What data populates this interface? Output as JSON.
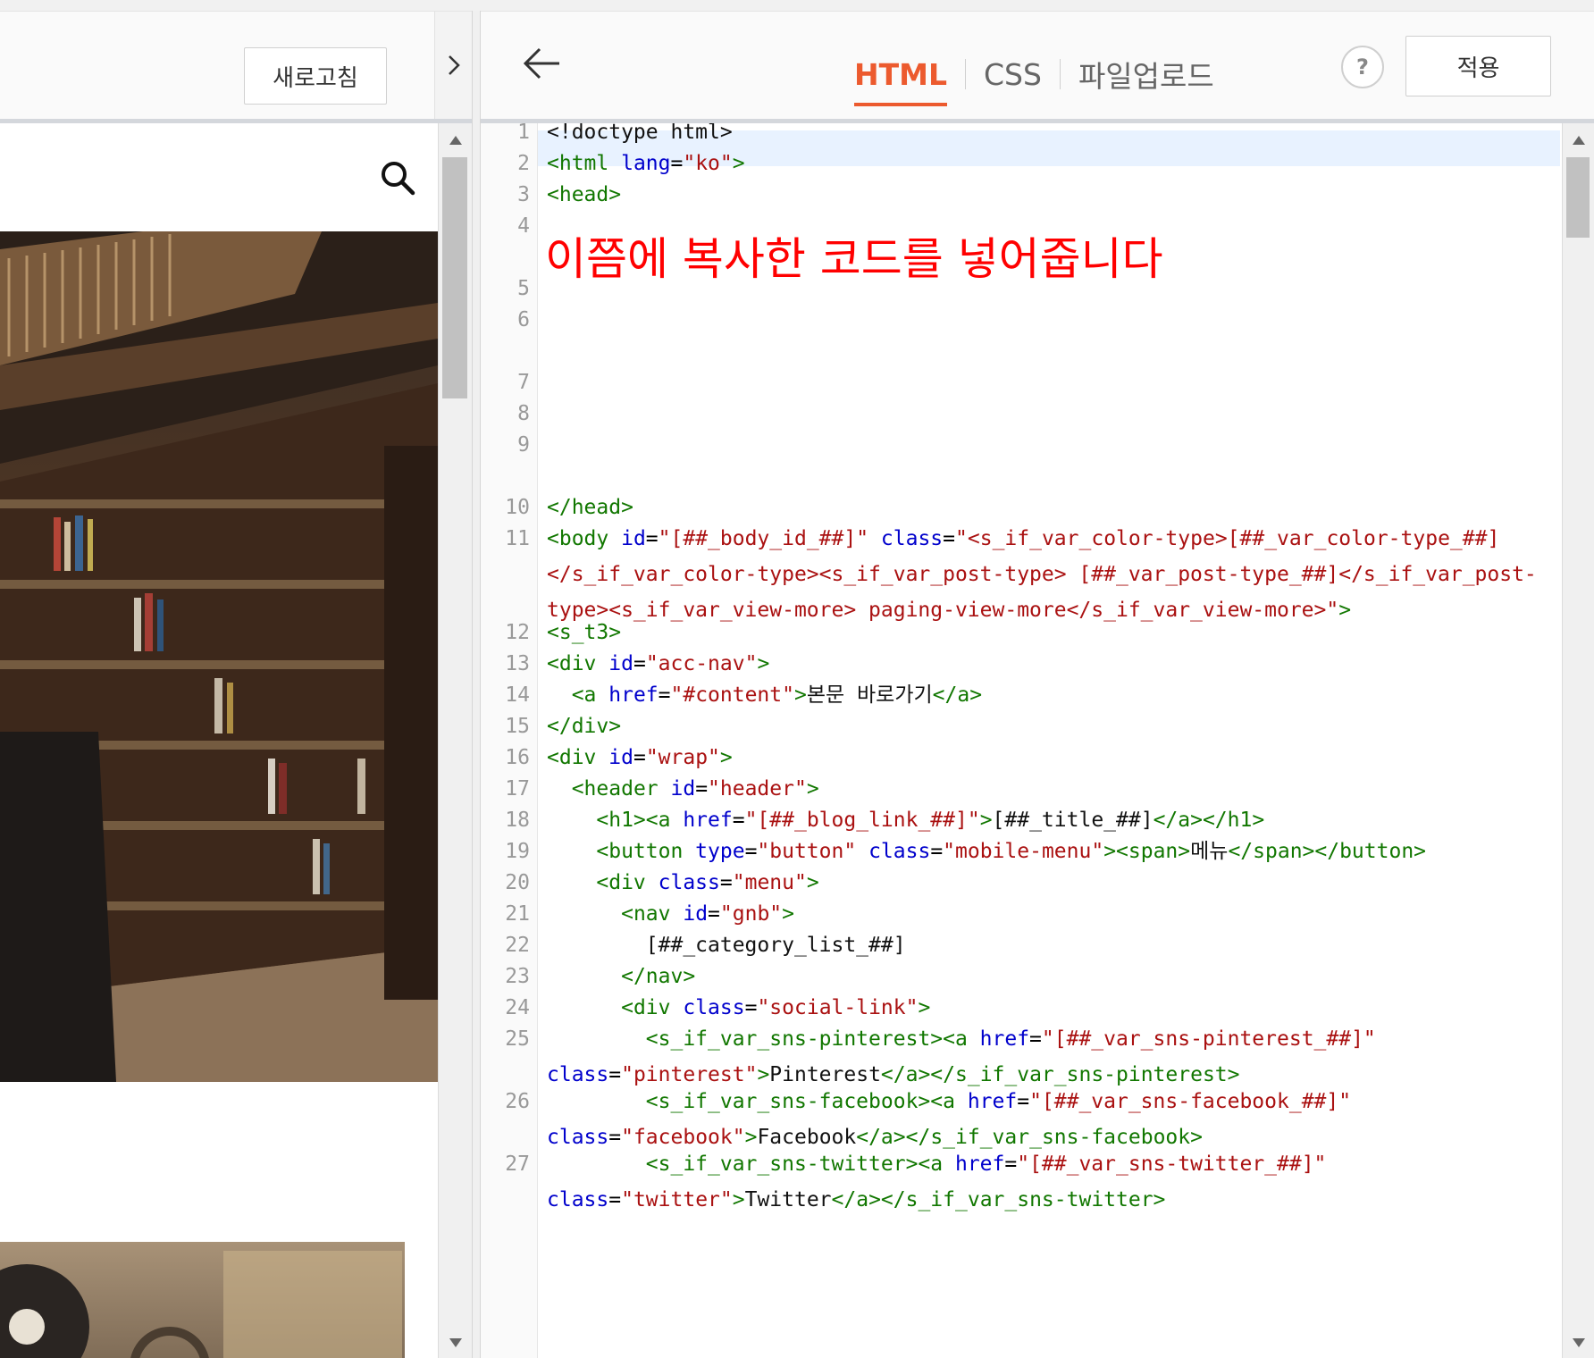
{
  "left_panel": {
    "refresh_label": "새로고침",
    "collapse_icon": "chevron-right-icon",
    "search_icon": "search-icon"
  },
  "editor": {
    "back_icon": "arrow-left-icon",
    "tabs": [
      {
        "label": "HTML",
        "active": true
      },
      {
        "label": "CSS",
        "active": false
      },
      {
        "label": "파일업로드",
        "active": false
      }
    ],
    "help_label": "?",
    "apply_label": "적용",
    "accent_color": "#ec5a2e",
    "annotation": "이쯤에 복사한 코드를 넣어줍니다",
    "line_numbers": [
      "1",
      "2",
      "3",
      "4",
      "5",
      "6",
      "7",
      "8",
      "9",
      "10",
      "11",
      "12",
      "13",
      "14",
      "15",
      "16",
      "17",
      "18",
      "19",
      "20",
      "21",
      "22",
      "23",
      "24",
      "25",
      "26",
      "27"
    ]
  },
  "code": {
    "l1": "<!doctype html>",
    "l2": {
      "open": "<html ",
      "attr": "lang",
      "eq": "=",
      "val": "\"ko\"",
      "close": ">"
    },
    "l3": "<head>",
    "l10": "</head>",
    "l11": {
      "open": "<body ",
      "a1": "id",
      "eq": "=",
      "v1": "\"[##_body_id_##]\"",
      "a2": "class",
      "v2": "\"<s_if_var_color-type>[##_var_color-type_##]</s_if_var_color-type><s_if_var_post-type> [##_var_post-type_##]</s_if_var_post-type><s_if_var_view-more> paging-view-more</s_if_var_view-more>\"",
      "close": ">"
    },
    "l12": "<s_t3>",
    "l13": {
      "open": "<div ",
      "attr": "id",
      "eq": "=",
      "val": "\"acc-nav\"",
      "close": ">"
    },
    "l14": {
      "indent": "  ",
      "open": "<a ",
      "attr": "href",
      "eq": "=",
      "val": "\"#content\"",
      "close": ">",
      "text": "본문 바로가기",
      "end": "</a>"
    },
    "l15": "</div>",
    "l16": {
      "open": "<div ",
      "attr": "id",
      "eq": "=",
      "val": "\"wrap\"",
      "close": ">"
    },
    "l17": {
      "indent": "  ",
      "open": "<header ",
      "attr": "id",
      "eq": "=",
      "val": "\"header\"",
      "close": ">"
    },
    "l18": {
      "indent": "    ",
      "open": "<h1><a ",
      "attr": "href",
      "eq": "=",
      "val": "\"[##_blog_link_##]\"",
      "close": ">",
      "text": "[##_title_##]",
      "end": "</a></h1>"
    },
    "l19": {
      "indent": "    ",
      "open": "<button ",
      "a1": "type",
      "eq": "=",
      "v1": "\"button\"",
      "a2": "class",
      "v2": "\"mobile-menu\"",
      "close": "><span>",
      "text": "메뉴",
      "end": "</span></button>"
    },
    "l20": {
      "indent": "    ",
      "open": "<div ",
      "attr": "class",
      "eq": "=",
      "val": "\"menu\"",
      "close": ">"
    },
    "l21": {
      "indent": "      ",
      "open": "<nav ",
      "attr": "id",
      "eq": "=",
      "val": "\"gnb\"",
      "close": ">"
    },
    "l22": {
      "indent": "        ",
      "text": "[##_category_list_##]"
    },
    "l23": {
      "indent": "      ",
      "text": "</nav>"
    },
    "l24": {
      "indent": "      ",
      "open": "<div ",
      "attr": "class",
      "eq": "=",
      "val": "\"social-link\"",
      "close": ">"
    },
    "l25": {
      "indent": "        ",
      "open": "<s_if_var_sns-pinterest><a ",
      "a1": "href",
      "eq": "=",
      "v1": "\"[##_var_sns-pinterest_##]\"",
      "a2": "class",
      "v2": "\"pinterest\"",
      "close": ">",
      "text": "Pinterest",
      "end": "</a></s_if_var_sns-pinterest>"
    },
    "l26": {
      "indent": "        ",
      "open": "<s_if_var_sns-facebook><a ",
      "a1": "href",
      "eq": "=",
      "v1": "\"[##_var_sns-facebook_##]\"",
      "a2": "class",
      "v2": "\"facebook\"",
      "close": ">",
      "text": "Facebook",
      "end": "</a></s_if_var_sns-facebook>"
    },
    "l27": {
      "indent": "        ",
      "open": "<s_if_var_sns-twitter><a ",
      "a1": "href",
      "eq": "=",
      "v1": "\"[##_var_sns-twitter_##]\"",
      "a2": "class",
      "v2": "\"twitter\"",
      "close": ">",
      "text": "Twitter",
      "end": "</a></s_if_var_sns-twitter>"
    }
  }
}
